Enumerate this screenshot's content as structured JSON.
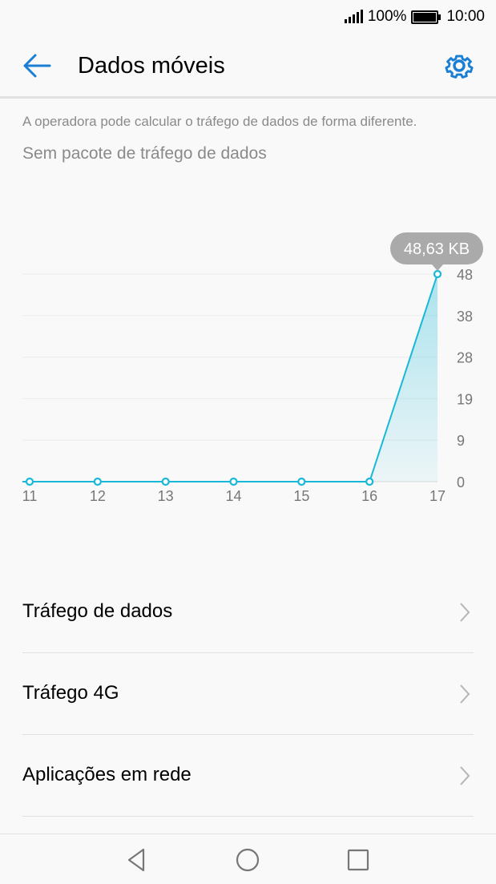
{
  "status_bar": {
    "battery": "100%",
    "time": "10:00"
  },
  "header": {
    "title": "Dados móveis"
  },
  "notice": "A operadora pode calcular o tráfego de dados de forma diferente.",
  "package_status": "Sem pacote de tráfego de dados",
  "chart_data": {
    "type": "line",
    "x": [
      "11",
      "12",
      "13",
      "14",
      "15",
      "16",
      "17"
    ],
    "values": [
      0,
      0,
      0,
      0,
      0,
      0,
      48.63
    ],
    "y_ticks": [
      "0",
      "9",
      "19",
      "28",
      "38",
      "48"
    ],
    "ylim": [
      0,
      48.63
    ],
    "tooltip": "48,63 KB",
    "grid": true,
    "color": "#1ab8d8"
  },
  "list": {
    "items": [
      {
        "label": "Tráfego de dados"
      },
      {
        "label": "Tráfego 4G"
      },
      {
        "label": "Aplicações em rede"
      }
    ]
  },
  "colors": {
    "accent": "#1a7fd4",
    "chart_line": "#1ab8d8"
  }
}
